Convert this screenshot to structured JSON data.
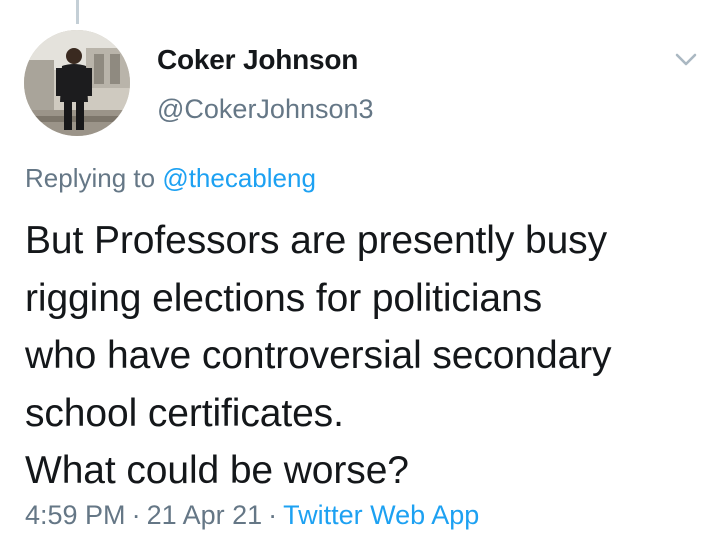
{
  "tweet": {
    "author": {
      "display_name": "Coker Johnson",
      "handle": "@CokerJohnson3"
    },
    "reply_context": {
      "prefix": "Replying to",
      "mention": "@thecableng"
    },
    "text_lines": [
      "But Professors are presently busy",
      "rigging elections for politicians",
      "who have controversial secondary",
      "school certificates.",
      "What could be worse?"
    ],
    "time": "4:59 PM",
    "date": "21 Apr 21",
    "source": "Twitter Web App",
    "separator": "·"
  },
  "icons": {
    "menu": "chevron-down-icon",
    "avatar": "user-photo"
  },
  "colors": {
    "text_primary": "#14171a",
    "text_secondary": "#657786",
    "link": "#1da1f2",
    "thread_line": "#c4cfd6",
    "background": "#ffffff"
  }
}
